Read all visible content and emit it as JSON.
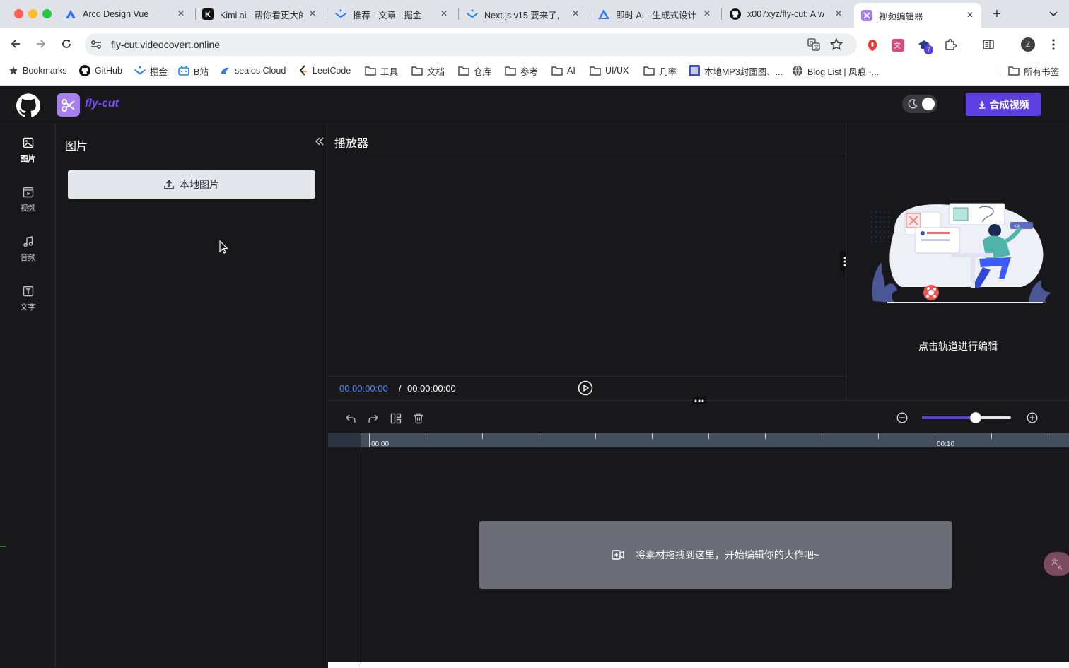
{
  "browser": {
    "tabs": [
      {
        "title": "Arco Design Vue",
        "icon": "arco-icon"
      },
      {
        "title": "Kimi.ai - 帮你看更大的",
        "icon": "kimi-icon"
      },
      {
        "title": "推荐 - 文章 - 掘金",
        "icon": "juejin-icon"
      },
      {
        "title": "Next.js v15 要来了,",
        "icon": "juejin-icon"
      },
      {
        "title": "即时 AI - 生成式设计",
        "icon": "jishi-icon"
      },
      {
        "title": "x007xyz/fly-cut: A w",
        "icon": "github-icon"
      },
      {
        "title": "视频编辑器",
        "icon": "flycut-icon"
      }
    ],
    "url": "fly-cut.videocovert.online",
    "extension_badge": "7",
    "profile_initial": "Z",
    "bookmarks": [
      {
        "label": "Bookmarks",
        "icon": "star-icon"
      },
      {
        "label": "GitHub",
        "icon": "github-icon"
      },
      {
        "label": "掘金",
        "icon": "juejin-icon"
      },
      {
        "label": "B站",
        "icon": "bilibili-icon"
      },
      {
        "label": "sealos Cloud",
        "icon": "sealos-icon"
      },
      {
        "label": "LeetCode",
        "icon": "leetcode-icon"
      },
      {
        "label": "工具",
        "icon": "folder-icon"
      },
      {
        "label": "文档",
        "icon": "folder-icon"
      },
      {
        "label": "仓库",
        "icon": "folder-icon"
      },
      {
        "label": "参考",
        "icon": "folder-icon"
      },
      {
        "label": "AI",
        "icon": "folder-icon"
      },
      {
        "label": "UI/UX",
        "icon": "folder-icon"
      },
      {
        "label": "几率",
        "icon": "folder-icon"
      },
      {
        "label": "本地MP3封面图、...",
        "icon": "mp3-icon"
      },
      {
        "label": "Blog List | 风痕 ·...",
        "icon": "globe-icon"
      }
    ],
    "all_bookmarks": "所有书签"
  },
  "app": {
    "logo_text": "fly-cut",
    "export_button": "合成视频",
    "accent": "#5b3fe0",
    "nav": [
      {
        "label": "图片",
        "icon": "image-icon",
        "active": true
      },
      {
        "label": "视频",
        "icon": "video-icon",
        "active": false
      },
      {
        "label": "音频",
        "icon": "music-icon",
        "active": false
      },
      {
        "label": "文字",
        "icon": "text-icon",
        "active": false
      }
    ],
    "panel": {
      "title": "图片",
      "upload_button": "本地图片"
    },
    "player": {
      "title": "播放器",
      "current_time": "00:00:00:00",
      "separator": "/",
      "total_time": "00:00:00:00"
    },
    "props": {
      "hint": "点击轨道进行编辑"
    },
    "timeline": {
      "tick_start": "00:00",
      "tick_end": "00:10",
      "zoom_level": 0.6,
      "empty_hint": "将素材拖拽到这里，开始编辑你的大作吧~"
    }
  }
}
